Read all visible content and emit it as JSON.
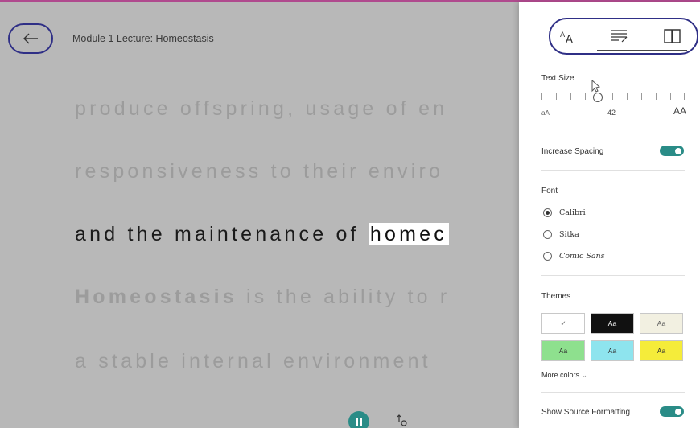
{
  "reader": {
    "title": "Module 1 Lecture: Homeostasis",
    "lines": [
      "produce offspring, usage of en",
      "responsiveness to their enviro",
      "and the maintenance of ",
      "homec",
      "Homeostasis",
      " is the ability to r",
      "a stable internal environment"
    ]
  },
  "panel": {
    "text_size_label": "Text Size",
    "text_size_value": "42",
    "text_size_fraction": 0.39,
    "small_a": "aA",
    "big_a": "AA",
    "increase_spacing_label": "Increase Spacing",
    "increase_spacing_on": true,
    "font_label": "Font",
    "fonts": [
      {
        "name": "Calibri",
        "selected": true
      },
      {
        "name": "Sitka",
        "selected": false
      },
      {
        "name": "Comic Sans",
        "selected": false
      }
    ],
    "themes_label": "Themes",
    "themes": [
      {
        "label": "✓",
        "bg": "#ffffff",
        "fg": "#555555"
      },
      {
        "label": "Aa",
        "bg": "#111111",
        "fg": "#ffffff"
      },
      {
        "label": "Aa",
        "bg": "#f2f0e1",
        "fg": "#555555"
      },
      {
        "label": "Aa",
        "bg": "#8ee08e",
        "fg": "#333333"
      },
      {
        "label": "Aa",
        "bg": "#8ee4ee",
        "fg": "#333333"
      },
      {
        "label": "Aa",
        "bg": "#f5ec3a",
        "fg": "#333333"
      }
    ],
    "more_colors_label": "More colors",
    "show_source_label": "Show Source Formatting",
    "show_source_on": true
  },
  "colors": {
    "accent": "#2a8c87",
    "highlight_border": "#2f2f86"
  }
}
